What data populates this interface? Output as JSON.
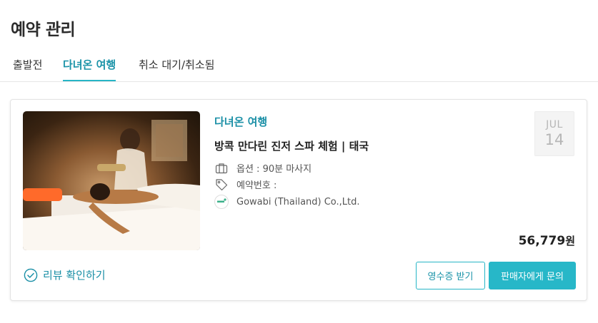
{
  "page": {
    "title": "예약 관리"
  },
  "tabs": [
    {
      "label": "출발전",
      "active": false
    },
    {
      "label": "다녀온 여행",
      "active": true
    },
    {
      "label": "취소 대기/취소됨",
      "active": false
    }
  ],
  "reservation": {
    "status": "다녀온 여행",
    "product_name": "방콕 만다린 진저 스파 체험 | 태국",
    "option": "옵션 : 90분 마사지",
    "reservation_number": "예약번호 :",
    "seller": "Gowabi (Thailand) Co.,Ltd.",
    "date": {
      "month": "JUL",
      "day": "14"
    },
    "price": {
      "amount": "56,779",
      "unit": "원"
    },
    "review_link": "리뷰 확인하기",
    "buttons": {
      "receipt": "영수증 받기",
      "contact": "판매자에게 문의"
    },
    "icons": {
      "option": "briefcase-icon",
      "reservation": "tag-icon",
      "seller": "seller-logo-icon",
      "review": "check-circle-icon"
    }
  },
  "colors": {
    "accent": "#27b5c6",
    "accent_text": "#1a8fa6"
  }
}
